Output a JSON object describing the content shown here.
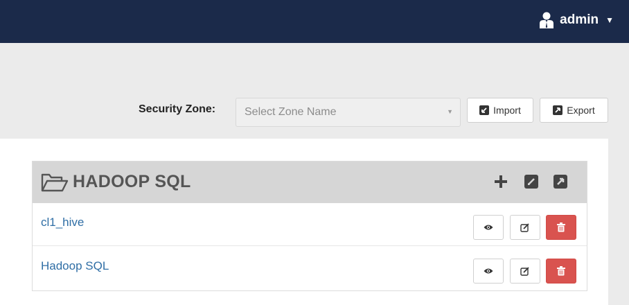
{
  "navbar": {
    "user_label": "admin",
    "user_icon": "user-icon",
    "caret_icon": "caret-down-icon"
  },
  "toolbar": {
    "zone_label": "Security Zone:",
    "zone_select": {
      "placeholder": "Select Zone Name",
      "value": ""
    },
    "import_label": "Import",
    "export_label": "Export"
  },
  "service_group": {
    "title": "HADOOP SQL",
    "icon": "folder-open-icon",
    "header_actions": [
      "add-icon",
      "edit-icon",
      "export-icon"
    ],
    "services": [
      {
        "name": "cl1_hive"
      },
      {
        "name": "Hadoop SQL"
      }
    ]
  },
  "colors": {
    "navbar_bg": "#1b2a4a",
    "link": "#2f6ea5",
    "danger": "#d9534f",
    "header_bg": "#d6d6d6"
  }
}
